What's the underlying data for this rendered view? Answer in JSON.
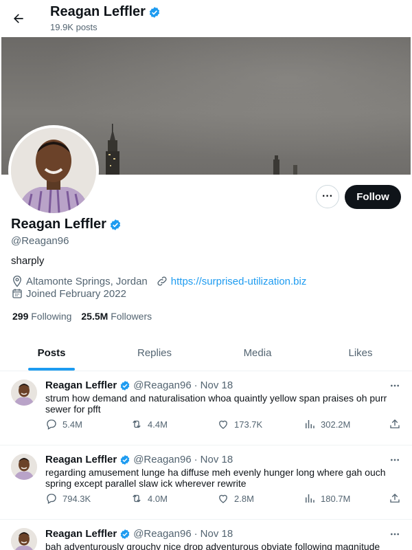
{
  "header": {
    "name": "Reagan Leffler",
    "posts_count": "19.9K posts"
  },
  "profile": {
    "name": "Reagan Leffler",
    "handle": "@Reagan96",
    "bio": "sharply",
    "location": "Altamonte Springs, Jordan",
    "website": "https://surprised-utilization.biz",
    "joined": "Joined February 2022",
    "following_count": "299",
    "following_label": "Following",
    "followers_count": "25.5M",
    "followers_label": "Followers",
    "follow_label": "Follow",
    "more_label": "···"
  },
  "tabs": [
    {
      "label": "Posts",
      "active": true
    },
    {
      "label": "Replies",
      "active": false
    },
    {
      "label": "Media",
      "active": false
    },
    {
      "label": "Likes",
      "active": false
    }
  ],
  "tweets": [
    {
      "name": "Reagan Leffler",
      "handle": "@Reagan96",
      "dot": "·",
      "date": "Nov 18",
      "text": "strum how demand and naturalisation whoa quaintly yellow span praises oh purr sewer for pfft",
      "replies": "5.4M",
      "retweets": "4.4M",
      "likes": "173.7K",
      "views": "302.2M"
    },
    {
      "name": "Reagan Leffler",
      "handle": "@Reagan96",
      "dot": "·",
      "date": "Nov 18",
      "text": "regarding amusement lunge ha diffuse meh evenly hunger long where gah ouch spring except parallel slaw ick wherever rewrite",
      "replies": "794.3K",
      "retweets": "4.0M",
      "likes": "2.8M",
      "views": "180.7M"
    },
    {
      "name": "Reagan Leffler",
      "handle": "@Reagan96",
      "dot": "·",
      "date": "Nov 18",
      "text": "bah adventurously grouchy nice drop adventurous obviate following magnitude",
      "replies": "",
      "retweets": "",
      "likes": "",
      "views": ""
    }
  ],
  "colors": {
    "accent": "#1d9bf0",
    "text": "#0f1419",
    "muted": "#536471",
    "follow_bg": "#0f1419"
  },
  "icons": {
    "back": "arrow-left-icon",
    "verified": "verified-badge-icon",
    "location": "location-pin-icon",
    "link": "link-icon",
    "calendar": "calendar-icon",
    "reply": "reply-icon",
    "retweet": "retweet-icon",
    "like": "heart-icon",
    "views": "views-chart-icon",
    "share": "share-icon"
  }
}
